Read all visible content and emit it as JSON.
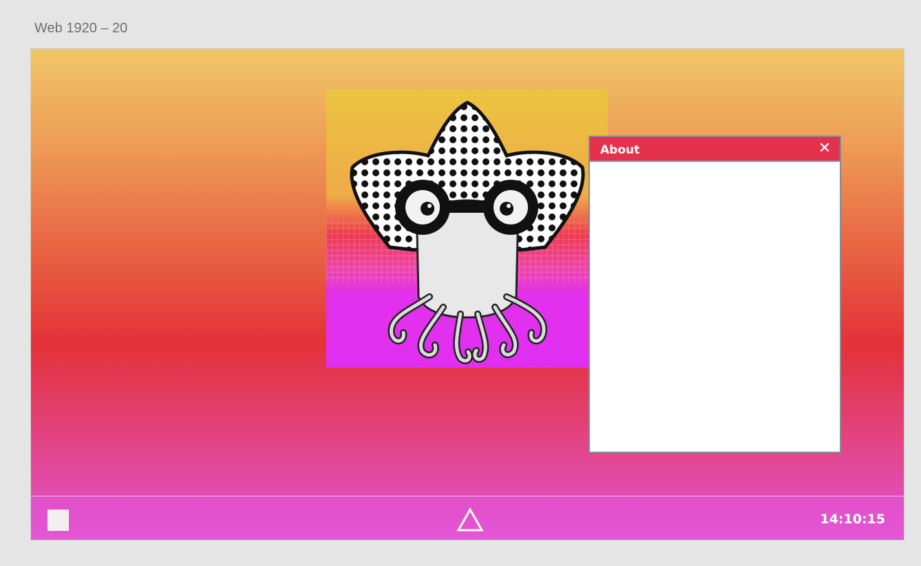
{
  "canvas": {
    "frame_title": "Web 1920 – 20"
  },
  "artwork": {
    "subject": "squid-with-glasses-illustration"
  },
  "about_window": {
    "title": "About",
    "close_glyph": "✕",
    "title_color": "#e4324d"
  },
  "taskbar": {
    "start_icon": "square-icon",
    "home_icon": "triangle-icon",
    "clock_time": "14:10:15"
  },
  "colors": {
    "gradient_top": "#f0c766",
    "gradient_mid": "#e43138",
    "gradient_bottom": "#e356d6",
    "window_border": "#8a8a93"
  }
}
